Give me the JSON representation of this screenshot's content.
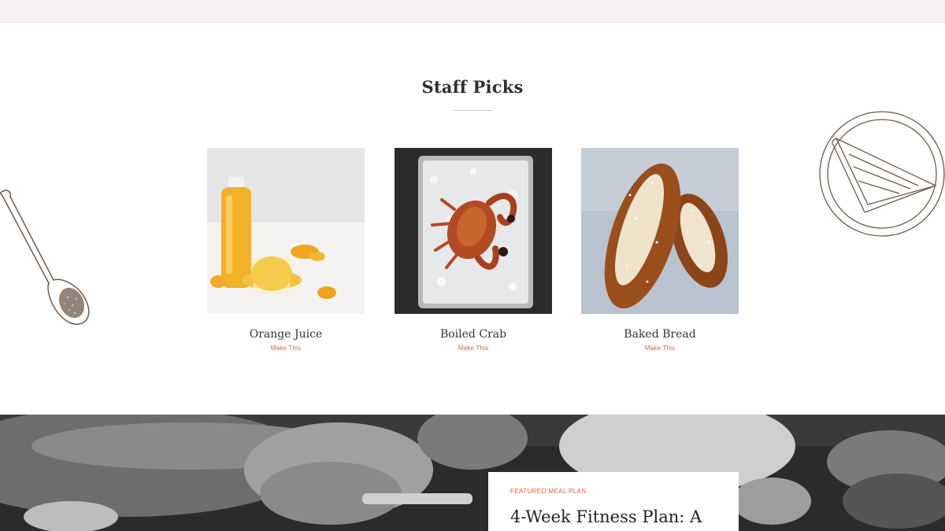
{
  "section": {
    "title": "Staff Picks"
  },
  "cards": [
    {
      "title": "Orange Juice",
      "link": "Make This",
      "image": "orange-juice-photo"
    },
    {
      "title": "Boiled Crab",
      "link": "Make This",
      "image": "boiled-crab-photo"
    },
    {
      "title": "Baked Bread",
      "link": "Make This",
      "image": "baked-bread-photo"
    }
  ],
  "decor": {
    "left": "spoon-illustration",
    "right": "plate-illustration"
  },
  "featured": {
    "label": "FEATURED MEAL PLAN",
    "title": "4-Week Fitness Plan: A",
    "background": "chef-cutting-photo"
  },
  "colors": {
    "accent": "#e0623d",
    "top_strip": "#f7f2f1",
    "text": "#2f2f2f"
  }
}
